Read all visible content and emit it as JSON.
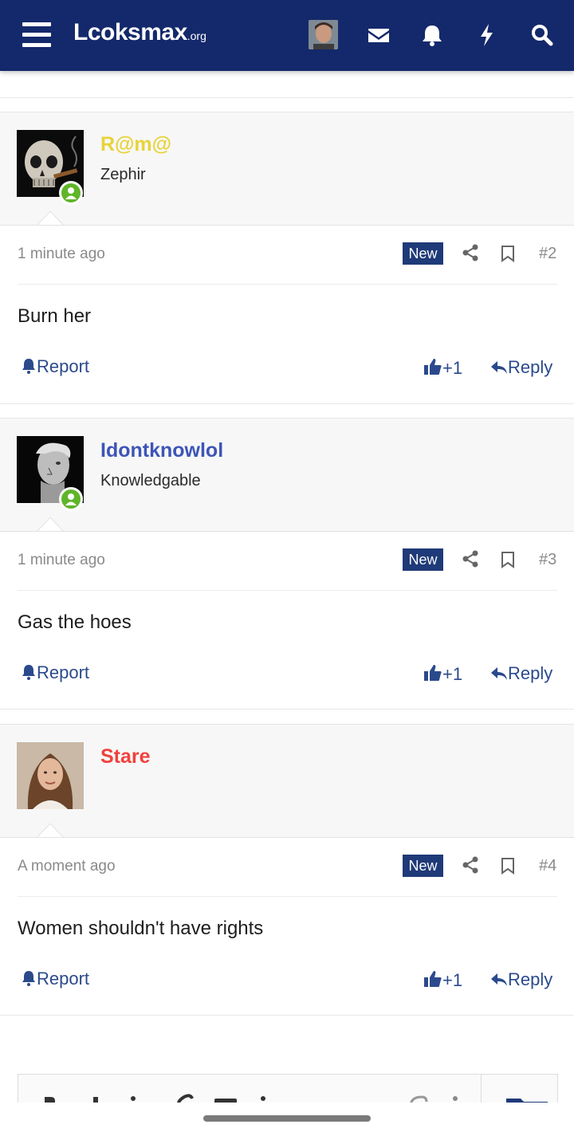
{
  "header": {
    "logo_main": "Lcoksmax",
    "logo_suffix": ".org",
    "icons": [
      "menu-icon",
      "envelope-icon",
      "bell-icon",
      "bolt-icon",
      "search-icon"
    ]
  },
  "posts": [
    {
      "username": "R@m@",
      "username_color": "#e8d33a",
      "user_title": "Zephir",
      "online": true,
      "time": "1 minute ago",
      "badge": "New",
      "number": "#2",
      "message": "Burn her",
      "report_label": "Report",
      "reaction_count": "+1",
      "reply_label": "Reply"
    },
    {
      "username": "Idontknowlol",
      "username_color": "#3d55b8",
      "user_title": "Knowledgable",
      "online": true,
      "time": "1 minute ago",
      "badge": "New",
      "number": "#3",
      "message": "Gas the hoes",
      "report_label": "Report",
      "reaction_count": "+1",
      "reply_label": "Reply"
    },
    {
      "username": "Stare",
      "username_color": "#f0413c",
      "user_title": "",
      "online": false,
      "time": "A moment ago",
      "badge": "New",
      "number": "#4",
      "message": "Women shouldn't have rights",
      "report_label": "Report",
      "reaction_count": "+1",
      "reply_label": "Reply"
    }
  ],
  "colors": {
    "header_bg": "#14296b",
    "link": "#2b4a8c",
    "badge_bg": "#1f3a78",
    "online": "#5fb52a"
  }
}
